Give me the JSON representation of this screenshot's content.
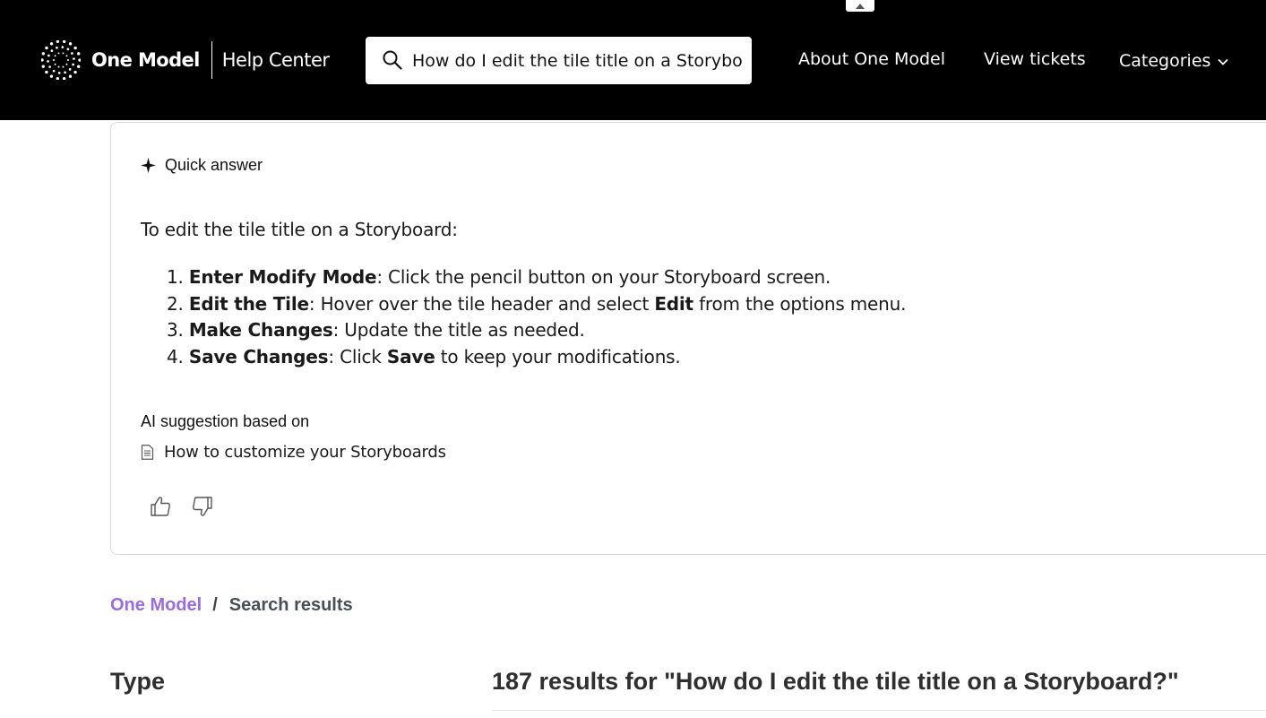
{
  "header": {
    "brand_name": "One Model",
    "brand_sub": "Help Center",
    "search": {
      "value": "How do I edit the tile title on a Storyboard?",
      "placeholder": "Search"
    },
    "nav": {
      "about": "About One Model",
      "tickets": "View tickets",
      "categories": "Categories"
    }
  },
  "quick_answer": {
    "label": "Quick answer",
    "intro": "To edit the tile title on a Storyboard:",
    "steps": [
      {
        "number": "1.",
        "title": "Enter Modify Mode",
        "text": ": Click the pencil button on your Storyboard screen."
      },
      {
        "number": "2.",
        "title": "Edit the Tile",
        "text_a": ": Hover over the tile header and select ",
        "bold": "Edit",
        "text_b": " from the options menu."
      },
      {
        "number": "3.",
        "title": "Make Changes",
        "text": ": Update the title as needed."
      },
      {
        "number": "4.",
        "title": "Save Changes",
        "text_a": ": Click ",
        "bold": "Save",
        "text_b": " to keep your modifications."
      }
    ],
    "based_on_label": "AI suggestion based on",
    "source_title": "How to customize your Storyboards"
  },
  "breadcrumb": {
    "home": "One Model",
    "separator": "/",
    "current": "Search results"
  },
  "filters": {
    "type_heading": "Type"
  },
  "results": {
    "heading": "187 results for \"How do I edit the tile title on a Storyboard?\""
  },
  "colors": {
    "header_bg": "#000000",
    "breadcrumb_link": "#9b6be0",
    "card_border": "#d8d8d8"
  },
  "icons": [
    "logo-mark-icon",
    "search-icon",
    "chevron-down-icon",
    "sparkle-icon",
    "document-icon",
    "thumbs-up-icon",
    "thumbs-down-icon",
    "caret-up-icon"
  ]
}
